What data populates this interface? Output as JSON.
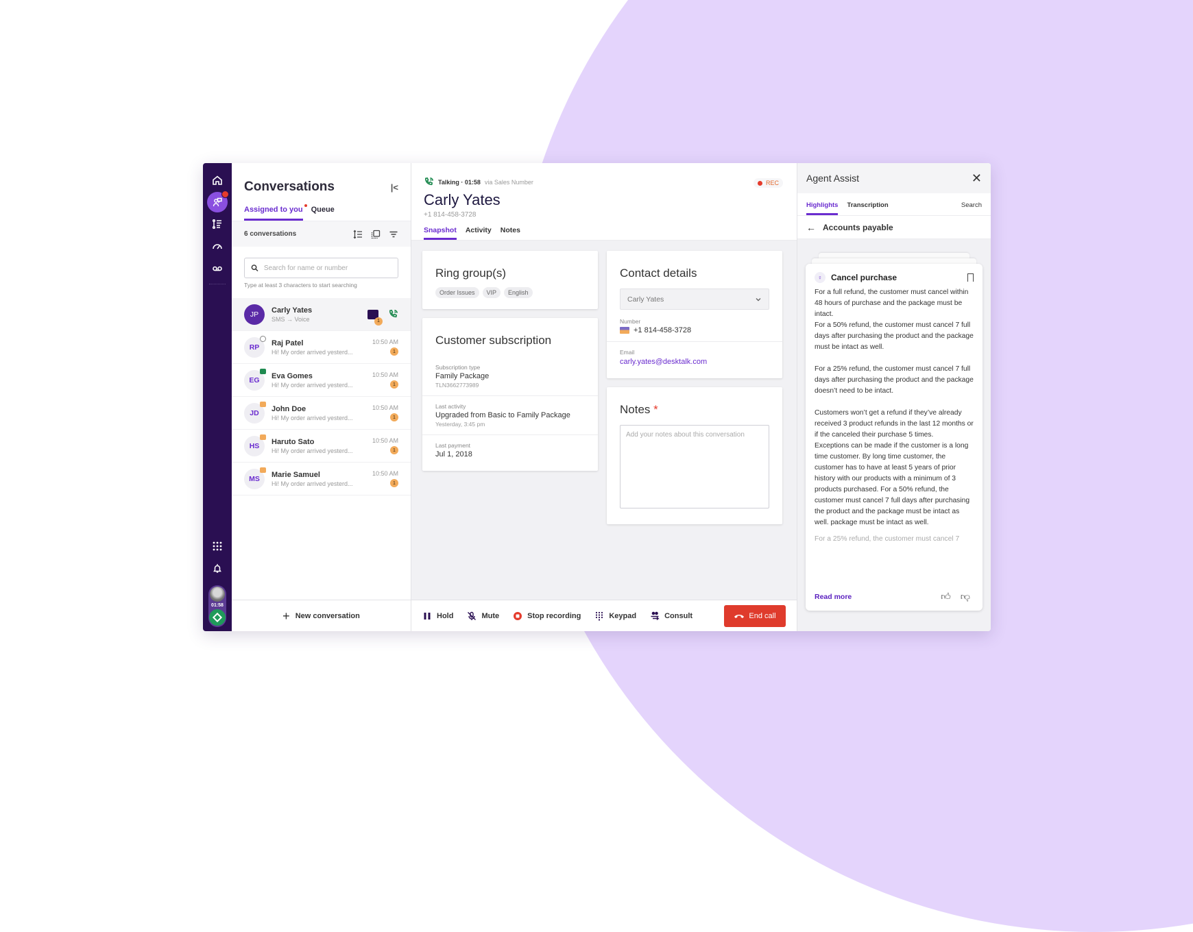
{
  "rail": {
    "items": [
      {
        "icon": "home-icon",
        "label": "Home"
      },
      {
        "icon": "conversations-icon",
        "label": "Conversations",
        "active": true,
        "badge": true
      },
      {
        "icon": "list-icon",
        "label": "Lists"
      },
      {
        "icon": "dashboard-icon",
        "label": "Dashboard"
      },
      {
        "icon": "voicemail-icon",
        "label": "Voicemail"
      }
    ],
    "bottom": {
      "apps_icon": "grid-icon",
      "notify_icon": "bell-icon",
      "call_timer": "01:58",
      "status_icon": "status-diamond-icon"
    }
  },
  "conversations": {
    "title": "Conversations",
    "tabs": [
      {
        "label": "Assigned to you",
        "active": true,
        "dot": true
      },
      {
        "label": "Queue",
        "active": false
      }
    ],
    "count_label": "6 conversations",
    "search": {
      "placeholder": "Search for name or number",
      "value": "",
      "hint": "Type at least 3 characters to start searching"
    },
    "items": [
      {
        "initials": "JP",
        "name": "Carly Yates",
        "subtitle": "SMS → Voice",
        "selected": true,
        "unread": "1"
      },
      {
        "initials": "RP",
        "name": "Raj Patel",
        "subtitle": "Hi! My order arrived yesterd...",
        "time": "10:50 AM",
        "unread": "1",
        "channel": "whatsapp"
      },
      {
        "initials": "EG",
        "name": "Eva Gomes",
        "subtitle": "Hi! My order arrived yesterd...",
        "time": "10:50 AM",
        "unread": "1",
        "channel": "green"
      },
      {
        "initials": "JD",
        "name": "John Doe",
        "subtitle": "Hi! My order arrived yesterd...",
        "time": "10:50 AM",
        "unread": "1",
        "channel": "orange"
      },
      {
        "initials": "HS",
        "name": "Haruto Sato",
        "subtitle": "Hi! My order arrived yesterd...",
        "time": "10:50 AM",
        "unread": "1",
        "channel": "orange"
      },
      {
        "initials": "MS",
        "name": "Marie Samuel",
        "subtitle": "Hi! My order arrived yesterd...",
        "time": "10:50 AM",
        "unread": "1",
        "channel": "orange"
      }
    ],
    "new_conversation_label": "New conversation"
  },
  "call": {
    "status": "Talking · 01:58",
    "via": "via Sales Number",
    "rec_label": "REC",
    "caller_name": "Carly Yates",
    "caller_phone": "+1 814-458-3728",
    "tabs": [
      {
        "label": "Snapshot",
        "active": true
      },
      {
        "label": "Activity",
        "active": false
      },
      {
        "label": "Notes",
        "active": false
      }
    ]
  },
  "ring_groups": {
    "title": "Ring group(s)",
    "chips": [
      "Order Issues",
      "VIP",
      "English"
    ]
  },
  "subscription": {
    "title": "Customer subscription",
    "fields": [
      {
        "label": "Subscription type",
        "value": "Family Package",
        "sub": "TLN3662773989"
      },
      {
        "label": "Last activity",
        "value": "Upgraded from Basic to Family Package",
        "sub": "Yesterday, 3:45 pm"
      },
      {
        "label": "Last payment",
        "value": "Jul 1, 2018",
        "sub": ""
      }
    ]
  },
  "contact": {
    "title": "Contact details",
    "selected_contact": "Carly Yates",
    "number_label": "Number",
    "number": "+1 814-458-3728",
    "email_label": "Email",
    "email": "carly.yates@desktalk.com"
  },
  "notes": {
    "title": "Notes",
    "required_mark": "*",
    "placeholder": "Add your notes about this conversation",
    "value": ""
  },
  "call_controls": {
    "hold": "Hold",
    "mute": "Mute",
    "stop_recording": "Stop recording",
    "keypad": "Keypad",
    "consult": "Consult",
    "end_call": "End call"
  },
  "assist": {
    "title": "Agent Assist",
    "tabs": [
      {
        "label": "Highlights",
        "active": true
      },
      {
        "label": "Transcription",
        "active": false
      }
    ],
    "search_label": "Search",
    "breadcrumb": "Accounts payable",
    "card": {
      "title": "Cancel purchase",
      "paragraphs": [
        "For a full refund, the customer must cancel within 48 hours of purchase and the package must be intact.\nFor a 50% refund, the customer must cancel 7 full days after purchasing the product and the package must be intact as well.",
        "For a 25% refund, the customer must cancel 7 full days after purchasing the product and the package doesn’t need to be intact.",
        "Customers won’t get a refund if they’ve already received 3 product refunds in the last 12 months or if the canceled their purchase 5 times.\nExceptions can be made if the customer is a long time customer. By long time customer, the customer has to have at least 5 years of prior history with our products with a minimum of 3 products purchased. For a 50% refund, the customer must cancel 7 full days after purchasing the product and the package must be intact as well. package must be intact as well."
      ],
      "faded_line": "For a 25% refund, the customer must cancel 7",
      "read_more": "Read more"
    }
  },
  "colors": {
    "accent": "#6a2ccf",
    "rail": "#2a0f52",
    "end_call": "#df3b2c",
    "background_circle": "#e4d4fc",
    "unread": "#f2aa5a"
  }
}
